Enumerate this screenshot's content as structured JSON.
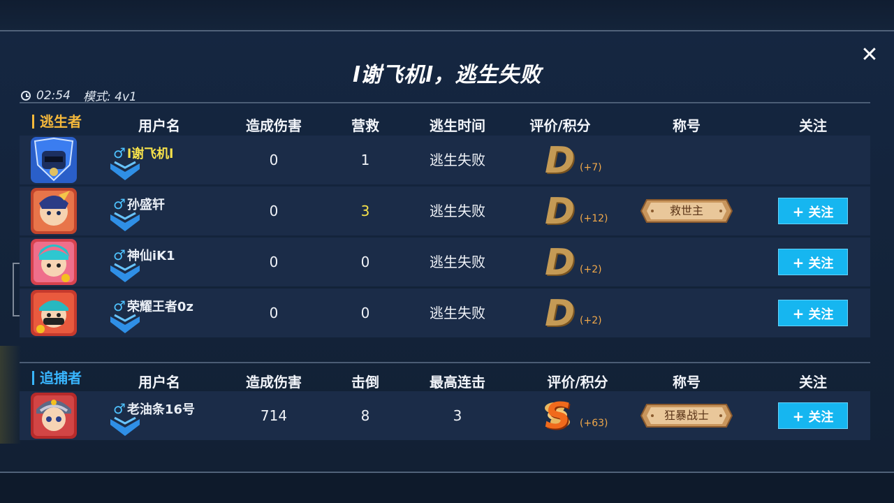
{
  "title": "l谢飞机l，逃生失败",
  "meta": {
    "time": "02:54",
    "mode": "模式: 4v1"
  },
  "escapers": {
    "team_label": "逃生者",
    "team_color": "#f6b93b",
    "headers": [
      "用户名",
      "造成伤害",
      "营救",
      "逃生时间",
      "评价/积分",
      "称号",
      "关注"
    ],
    "rows": [
      {
        "name": "l谢飞机l",
        "name_color": "#f7e24a",
        "damage": "0",
        "rescue": "1",
        "rescue_color": "#f0f3f8",
        "escape_time": "逃生失败",
        "grade": "D",
        "score": "(+7)",
        "badge": "",
        "follow": ""
      },
      {
        "name": "孙盛轩",
        "name_color": "#ffffff",
        "damage": "0",
        "rescue": "3",
        "rescue_color": "#f7e24a",
        "escape_time": "逃生失败",
        "grade": "D",
        "score": "(+12)",
        "badge": "救世主",
        "follow": "关注"
      },
      {
        "name": "神仙iK1",
        "name_color": "#ffffff",
        "damage": "0",
        "rescue": "0",
        "rescue_color": "#f0f3f8",
        "escape_time": "逃生失败",
        "grade": "D",
        "score": "(+2)",
        "badge": "",
        "follow": "关注"
      },
      {
        "name": "荣耀王者0z",
        "name_color": "#ffffff",
        "damage": "0",
        "rescue": "0",
        "rescue_color": "#f0f3f8",
        "escape_time": "逃生失败",
        "grade": "D",
        "score": "(+2)",
        "badge": "",
        "follow": "关注"
      }
    ]
  },
  "hunters": {
    "team_label": "追捕者",
    "team_color": "#39b6ff",
    "headers": [
      "用户名",
      "造成伤害",
      "击倒",
      "最高连击",
      "评价/积分",
      "称号",
      "关注"
    ],
    "rows": [
      {
        "name": "老油条16号",
        "name_color": "#ffffff",
        "damage": "714",
        "knockdown": "8",
        "combo": "3",
        "grade": "S",
        "score": "(+63)",
        "badge": "狂暴战士",
        "follow": "关注"
      }
    ]
  },
  "close_label": "✕",
  "follow_plus": "+",
  "icons": {
    "close": "close-icon",
    "clock": "clock-icon",
    "gender": "male-icon",
    "rank": "rank-chevron-icon"
  }
}
